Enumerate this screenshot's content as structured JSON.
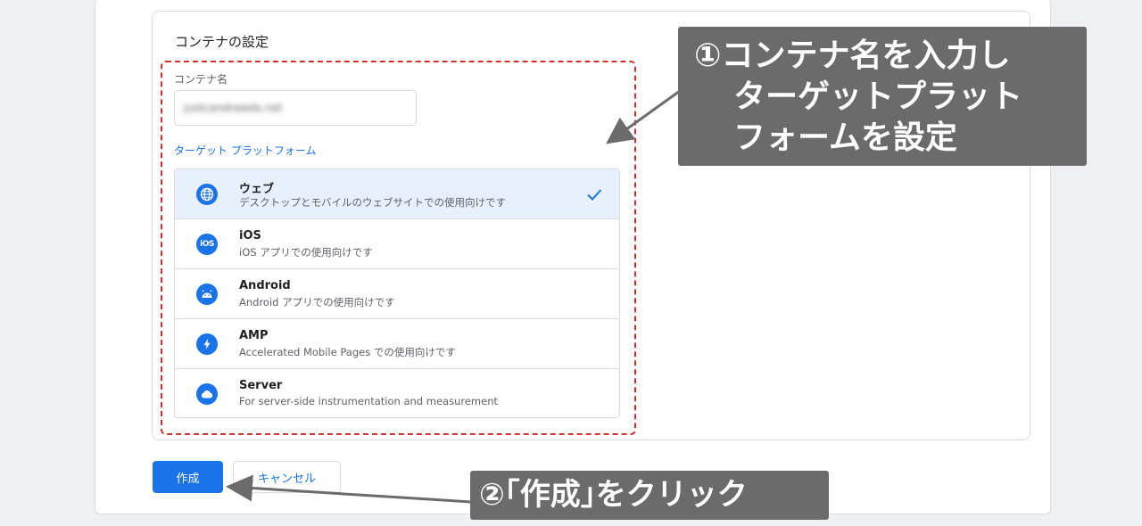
{
  "container_settings": {
    "title": "コンテナの設定",
    "name_label": "コンテナ名",
    "name_value": "justcandrawds.net",
    "platform_label": "ターゲット プラットフォーム",
    "platforms": [
      {
        "title": "ウェブ",
        "desc": "デスクトップとモバイルのウェブサイトでの使用向けです",
        "icon": "globe-icon",
        "selected": true
      },
      {
        "title": "iOS",
        "desc": "iOS アプリでの使用向けです",
        "icon": "ios-icon",
        "icon_text": "iOS",
        "selected": false
      },
      {
        "title": "Android",
        "desc": "Android アプリでの使用向けです",
        "icon": "android-icon",
        "selected": false
      },
      {
        "title": "AMP",
        "desc": "Accelerated Mobile Pages での使用向けです",
        "icon": "lightning-icon",
        "selected": false
      },
      {
        "title": "Server",
        "desc": "For server-side instrumentation and measurement",
        "icon": "cloud-icon",
        "selected": false
      }
    ]
  },
  "actions": {
    "create_label": "作成",
    "cancel_label": "キャンセル"
  },
  "annotations": {
    "callout_1_lines": [
      "①コンテナ名を入力し",
      "ターゲットプラット",
      "フォームを設定"
    ],
    "callout_2": "②｢作成｣をクリック"
  },
  "colors": {
    "accent": "#1a73e8",
    "selected_bg": "#e8f0fe",
    "highlight_border": "#d32f2f",
    "callout_bg": "#6b6b6b"
  }
}
